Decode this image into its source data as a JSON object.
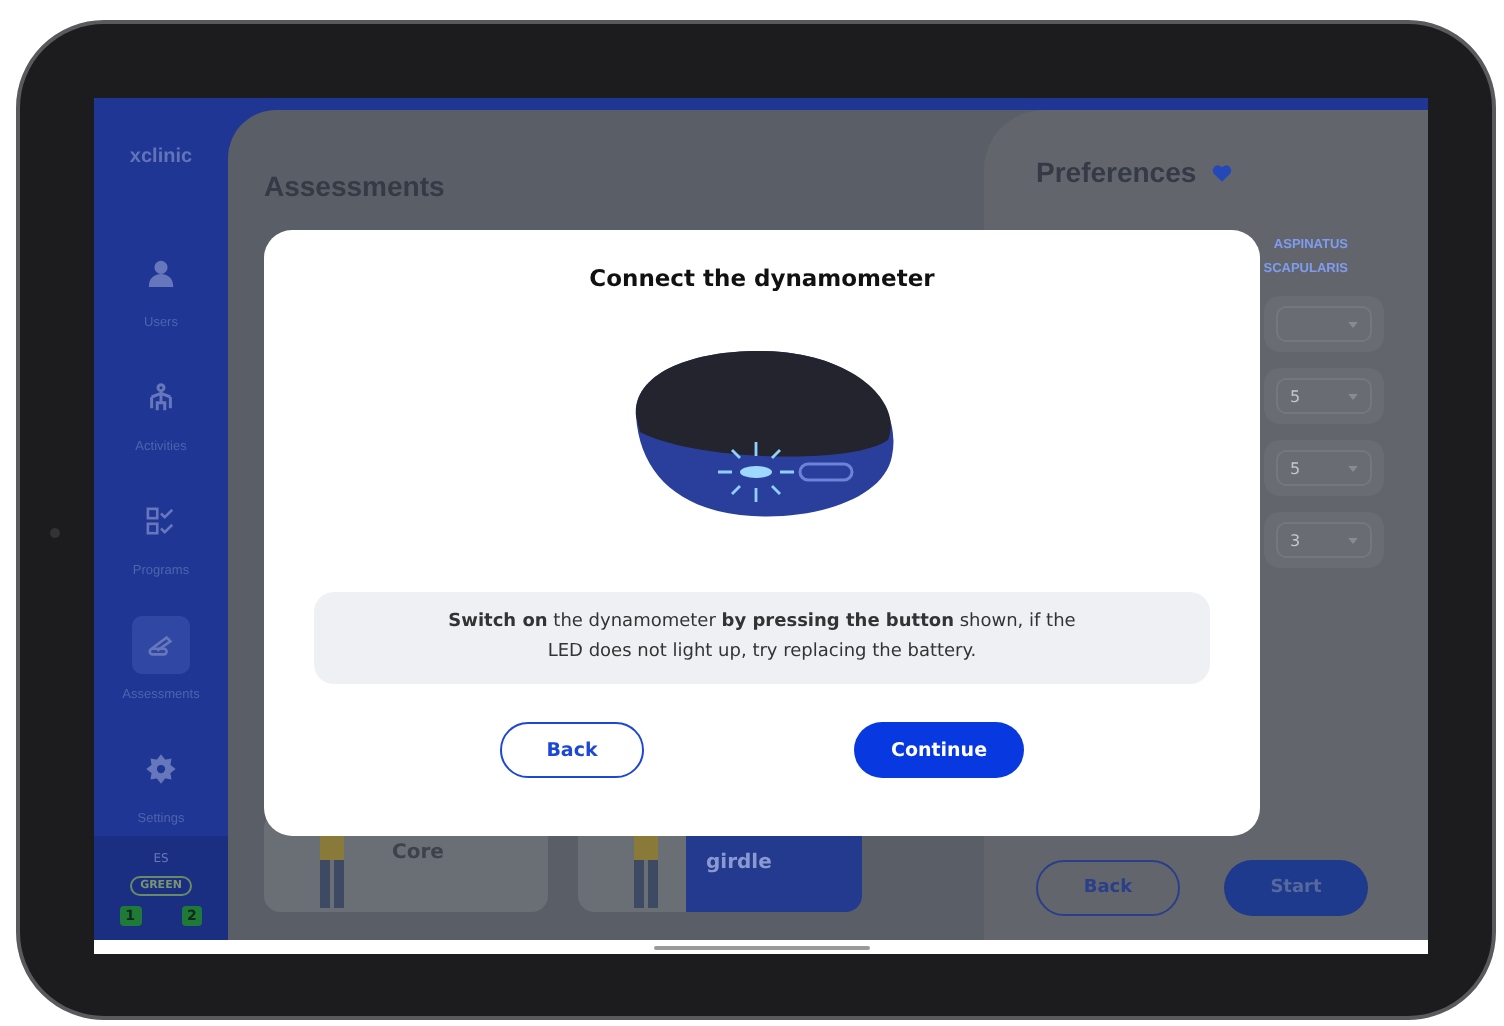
{
  "app_name": "xclinic",
  "sidebar": {
    "items": [
      {
        "label": "Users",
        "selected": false
      },
      {
        "label": "Activities",
        "selected": false
      },
      {
        "label": "Programs",
        "selected": false
      },
      {
        "label": "Assessments",
        "selected": true
      },
      {
        "label": "Settings",
        "selected": false
      }
    ],
    "footer": {
      "label": "ES",
      "badge": "GREEN",
      "counters": [
        "1",
        "2"
      ]
    }
  },
  "assessments": {
    "title": "Assessments",
    "cards": [
      {
        "label": "Core",
        "selected": false
      },
      {
        "label": "girdle",
        "selected": true
      }
    ]
  },
  "preferences": {
    "title": "Preferences",
    "muscles": [
      "ASPINATUS",
      "SCAPULARIS"
    ],
    "selects": [
      {
        "kind": "covered"
      },
      {
        "kind": "value",
        "value": "5"
      },
      {
        "kind": "value",
        "value": "5"
      },
      {
        "kind": "value",
        "value": "3"
      }
    ],
    "buttons": [
      {
        "label": "Back",
        "kind": "outline"
      },
      {
        "label": "Start",
        "kind": "primary"
      }
    ]
  },
  "modal": {
    "title": "Connect the dynamometer",
    "message": "**Switch on** the dynamometer **by pressing the button** shown, if the LED does not light up, try replacing the battery.",
    "buttons": [
      {
        "label": "Back",
        "kind": "outline"
      },
      {
        "label": "Continue",
        "kind": "primary"
      }
    ]
  }
}
